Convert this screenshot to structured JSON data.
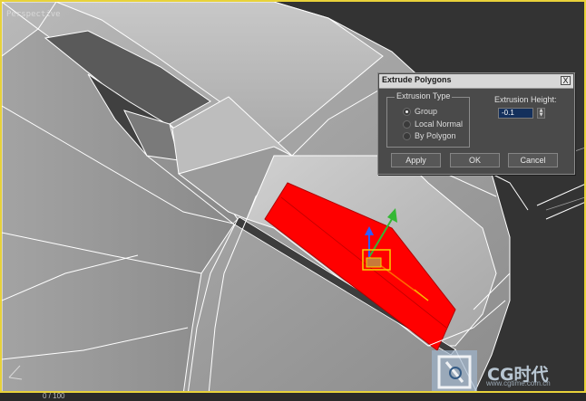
{
  "viewport": {
    "label": "Perspective",
    "active_border_color": "#e8d23a",
    "selection_color": "#ff0000"
  },
  "dialog": {
    "title": "Extrude Polygons",
    "close_label": "X",
    "extrusion_type": {
      "legend": "Extrusion Type",
      "options": [
        {
          "label": "Group",
          "selected": true
        },
        {
          "label": "Local Normal",
          "selected": false
        },
        {
          "label": "By Polygon",
          "selected": false
        }
      ]
    },
    "height": {
      "label": "Extrusion Height:",
      "value": "-0.1"
    },
    "buttons": {
      "apply": "Apply",
      "ok": "OK",
      "cancel": "Cancel"
    }
  },
  "status": {
    "frame_counter": "0 / 100"
  },
  "watermark": {
    "brand": "CG时代",
    "url": "www.cgtime.com.cn"
  },
  "icons": [
    "transform-gizmo-icon",
    "watermark-logo-icon",
    "close-icon"
  ]
}
